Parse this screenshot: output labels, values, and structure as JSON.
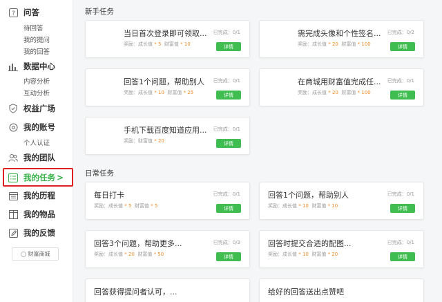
{
  "sidebar": {
    "groups": [
      {
        "label": "问答",
        "icon": "question-icon",
        "subs": [
          "待回答",
          "我的提问",
          "我的回答"
        ]
      },
      {
        "label": "数据中心",
        "icon": "bar-chart-icon",
        "subs": [
          "内容分析",
          "互动分析"
        ]
      },
      {
        "label": "权益广场",
        "icon": "shield-icon",
        "subs": []
      },
      {
        "label": "我的账号",
        "icon": "gear-icon",
        "subs": [
          "个人认证"
        ]
      },
      {
        "label": "我的团队",
        "icon": "team-icon",
        "subs": []
      },
      {
        "label": "我的任务",
        "icon": "task-icon",
        "subs": [],
        "active": true
      },
      {
        "label": "我的历程",
        "icon": "calendar-icon",
        "subs": []
      },
      {
        "label": "我的物品",
        "icon": "box-icon",
        "subs": []
      },
      {
        "label": "我的反馈",
        "icon": "edit-icon",
        "subs": []
      }
    ],
    "mall_label": "财富商城",
    "active_chevron": ">"
  },
  "main": {
    "new_section_title": "新手任务",
    "daily_section_title": "日常任务",
    "reward_prefix": "奖励：",
    "details_label": "详情",
    "new_tasks": [
      {
        "title": "当日首次登录即可领取...",
        "rewards": [
          {
            "name": "成长值",
            "value": "* 5"
          },
          {
            "name": "财富值",
            "value": "* 10"
          }
        ],
        "done": "已完成：0/1"
      },
      {
        "title": "需完成头像和个性签名...",
        "rewards": [
          {
            "name": "成长值",
            "value": "* 20"
          },
          {
            "name": "财富值",
            "value": "* 100"
          }
        ],
        "done": "已完成：0/2"
      },
      {
        "title": "回答1个问题，帮助别人",
        "rewards": [
          {
            "name": "成长值",
            "value": "* 10"
          },
          {
            "name": "财富值",
            "value": "* 25"
          }
        ],
        "done": "已完成：0/1"
      },
      {
        "title": "在商城用财富值完成任...",
        "rewards": [
          {
            "name": "成长值",
            "value": "* 20"
          },
          {
            "name": "财富值",
            "value": "* 100"
          }
        ],
        "done": "已完成：0/1"
      },
      {
        "title": "手机下载百度知道应用...",
        "rewards": [
          {
            "name": "财富值",
            "value": "* 20"
          }
        ],
        "done": "已完成：0/1"
      }
    ],
    "daily_tasks": [
      {
        "title": "每日打卡",
        "rewards": [
          {
            "name": "成长值",
            "value": "* 5"
          },
          {
            "name": "财富值",
            "value": "* 5"
          }
        ],
        "done": "已完成：0/1"
      },
      {
        "title": "回答1个问题，帮助别人",
        "rewards": [
          {
            "name": "成长值",
            "value": "* 10"
          },
          {
            "name": "财富值",
            "value": "* 10"
          }
        ],
        "done": "已完成：0/1"
      },
      {
        "title": "回答3个问题，帮助更多...",
        "rewards": [
          {
            "name": "成长值",
            "value": "* 20"
          },
          {
            "name": "财富值",
            "value": "* 50"
          }
        ],
        "done": "已完成：0/3"
      },
      {
        "title": "回答时提交合适的配图...",
        "rewards": [
          {
            "name": "成长值",
            "value": "* 10"
          },
          {
            "name": "财富值",
            "value": "* 20"
          }
        ],
        "done": "已完成：0/1"
      },
      {
        "title": "回答获得提问者认可，...",
        "rewards": [],
        "done": ""
      },
      {
        "title": "给好的回答送出点赞吧",
        "rewards": [],
        "done": ""
      }
    ]
  },
  "colors": {
    "accent": "#38b34a",
    "button": "#3fbd51",
    "reward": "#f08a24",
    "highlight_border": "#e02020"
  }
}
